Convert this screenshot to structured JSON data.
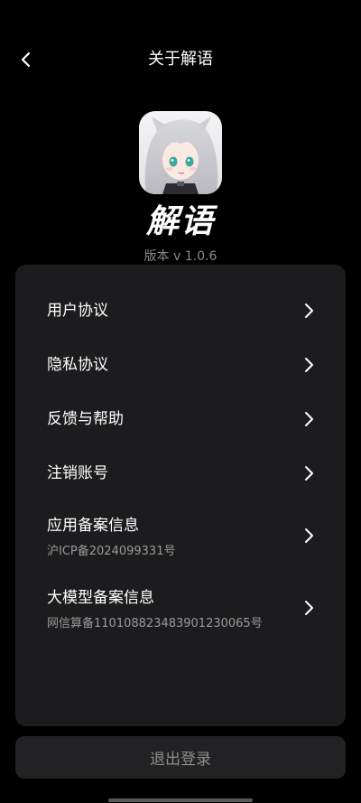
{
  "header": {
    "title": "关于解语",
    "back_icon": "chevron-left-icon"
  },
  "app": {
    "name": "解语",
    "version": "版本 v 1.0.6"
  },
  "menu": {
    "items": [
      {
        "label": "用户协议",
        "icon": "chevron-right-icon"
      },
      {
        "label": "隐私协议",
        "icon": "chevron-right-icon"
      },
      {
        "label": "反馈与帮助",
        "icon": "chevron-right-icon"
      },
      {
        "label": "注销账号",
        "icon": "chevron-right-icon"
      },
      {
        "label": "应用备案信息",
        "sub": "沪ICP备2024099331号",
        "icon": "chevron-right-icon"
      },
      {
        "label": "大模型备案信息",
        "sub": "网信算备110108823483901230065号",
        "icon": "chevron-right-icon"
      }
    ]
  },
  "logout": {
    "label": "退出登录"
  },
  "colors": {
    "background": "#000000",
    "card": "#1c1c1e",
    "secondary_text": "#8a8a8a",
    "button_text": "#8e8e8e"
  }
}
